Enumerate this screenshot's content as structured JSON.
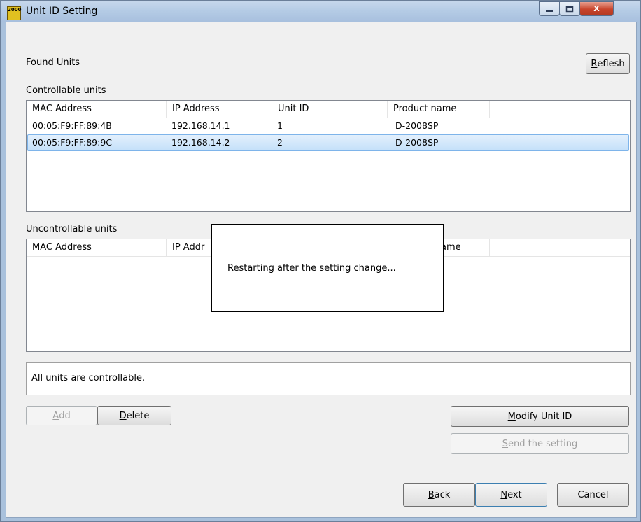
{
  "window": {
    "title": "Unit ID Setting",
    "icon_text": "2000",
    "minimize_icon": "minimize-icon",
    "maximize_icon": "maximize-icon",
    "close_icon": "close-icon",
    "close_glyph": "X"
  },
  "found_units_label": "Found Units",
  "refresh_button": {
    "mnemonic": "R",
    "rest": "eflesh"
  },
  "controllable": {
    "label": "Controllable units",
    "columns": [
      "MAC Address",
      "IP Address",
      "Unit ID",
      "Product name"
    ],
    "rows": [
      {
        "mac": "00:05:F9:FF:89:4B",
        "ip": "192.168.14.1",
        "unit_id": "1",
        "product": "D-2008SP",
        "selected": false
      },
      {
        "mac": "00:05:F9:FF:89:9C",
        "ip": "192.168.14.2",
        "unit_id": "2",
        "product": "D-2008SP",
        "selected": true
      }
    ]
  },
  "uncontrollable": {
    "label": "Uncontrollable units",
    "columns": [
      "MAC Address",
      "IP Addr",
      "ame"
    ]
  },
  "popup": {
    "message": "Restarting after the setting change..."
  },
  "status_text": "All units are controllable.",
  "buttons": {
    "add": {
      "mnemonic": "A",
      "rest": "dd"
    },
    "delete": {
      "mnemonic": "D",
      "rest": "elete"
    },
    "modify": {
      "mnemonic": "M",
      "rest": "odify Unit ID"
    },
    "send": {
      "mnemonic": "S",
      "rest": "end the setting"
    },
    "back": {
      "mnemonic": "B",
      "rest": "ack"
    },
    "next": {
      "mnemonic": "N",
      "rest": "ext"
    },
    "cancel": "Cancel"
  }
}
